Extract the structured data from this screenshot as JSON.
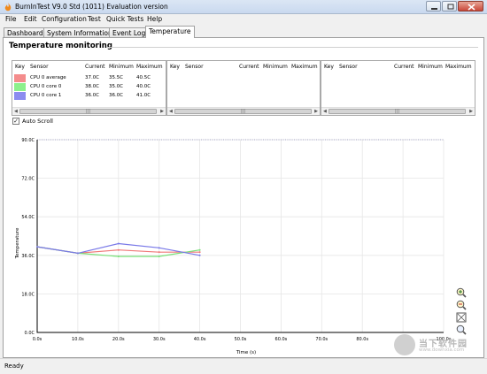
{
  "window": {
    "title": "BurnInTest V9.0 Std (1011) Evaluation version"
  },
  "menu": [
    {
      "label": "File"
    },
    {
      "label": "Edit"
    },
    {
      "label": "Configuration"
    },
    {
      "label": "Test"
    },
    {
      "label": "Quick Tests"
    },
    {
      "label": "Help"
    }
  ],
  "tabs": [
    {
      "label": "Dashboard",
      "active": false
    },
    {
      "label": "System Information",
      "active": false
    },
    {
      "label": "Event Log",
      "active": false
    },
    {
      "label": "Temperature",
      "active": true
    }
  ],
  "section": {
    "title": "Temperature monitoring"
  },
  "sensor_tables": [
    {
      "headers": [
        "Key",
        "Sensor",
        "Current",
        "Minimum",
        "Maximum"
      ],
      "rows": [
        {
          "key_color": "#f48c8c",
          "sensor": "CPU 0 average",
          "current": "37.0C",
          "minimum": "35.5C",
          "maximum": "40.5C"
        },
        {
          "key_color": "#8cf08c",
          "sensor": "CPU 0 core 0",
          "current": "38.0C",
          "minimum": "35.0C",
          "maximum": "40.0C"
        },
        {
          "key_color": "#8c8cf0",
          "sensor": "CPU 0 core 1",
          "current": "36.0C",
          "minimum": "36.0C",
          "maximum": "41.0C"
        }
      ]
    },
    {
      "headers": [
        "Key",
        "Sensor",
        "Current",
        "Minimum",
        "Maximum"
      ],
      "rows": []
    },
    {
      "headers": [
        "Key",
        "Sensor",
        "Current",
        "Minimum",
        "Maximum"
      ],
      "rows": []
    }
  ],
  "auto_scroll": {
    "label": "Auto Scroll",
    "checked": true
  },
  "chart_data": {
    "type": "line",
    "xlabel": "Time (s)",
    "ylabel": "Temperature",
    "x_ticks": [
      "0.0s",
      "10.0s",
      "20.0s",
      "30.0s",
      "40.0s",
      "50.0s",
      "60.0s",
      "70.0s",
      "80.0s",
      "90.0s",
      "100.0s"
    ],
    "y_ticks": [
      "0.0C",
      "18.0C",
      "36.0C",
      "54.0C",
      "72.0C",
      "90.0C"
    ],
    "xlim": [
      0,
      100
    ],
    "ylim": [
      0,
      90
    ],
    "reference_line": 90,
    "grid": true,
    "series": [
      {
        "color": "#f07878",
        "x": [
          0,
          10,
          20,
          30,
          40
        ],
        "y": [
          40,
          37,
          38.5,
          37.5,
          37.5
        ]
      },
      {
        "color": "#78e078",
        "x": [
          0,
          10,
          20,
          30,
          40
        ],
        "y": [
          40,
          37,
          35.5,
          35.5,
          38.5
        ]
      },
      {
        "color": "#7878e8",
        "x": [
          0,
          10,
          20,
          30,
          40
        ],
        "y": [
          40,
          37,
          41.5,
          39.5,
          36
        ]
      }
    ]
  },
  "zoom_tools": [
    {
      "icon": "zoom-in-icon"
    },
    {
      "icon": "zoom-out-icon"
    },
    {
      "icon": "zoom-fit-icon"
    },
    {
      "icon": "zoom-reset-icon"
    }
  ],
  "watermark": {
    "text": "当下软件园",
    "sub": "www.downxia.com"
  },
  "status": {
    "text": "Ready"
  }
}
